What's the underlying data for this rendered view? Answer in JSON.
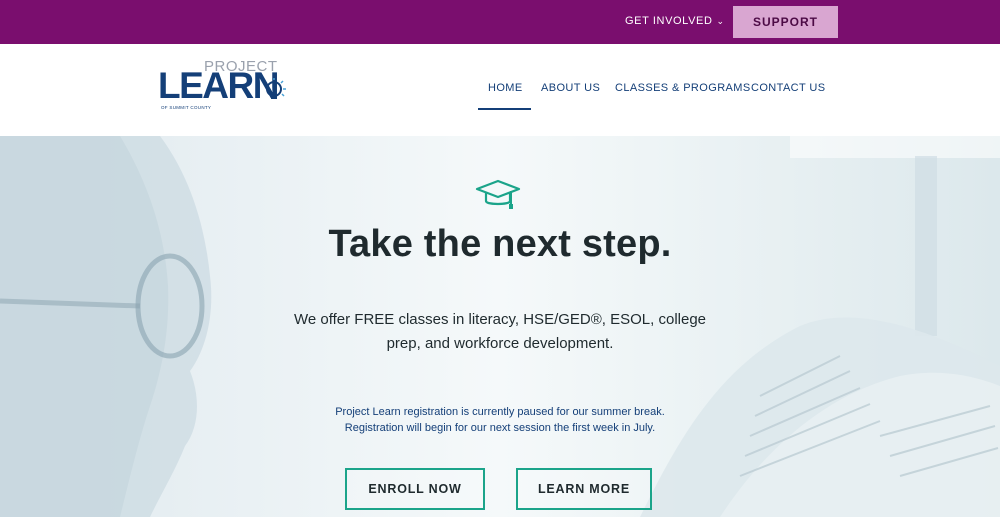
{
  "topbar": {
    "get_involved_label": "GET INVOLVED",
    "get_involved_chevron": "⌄",
    "support_label": "SUPPORT"
  },
  "logo": {
    "project_text": "PROJECT",
    "learn_text": "LEARN",
    "county_text": "OF SUMMIT COUNTY"
  },
  "nav": {
    "items": [
      {
        "label": "HOME"
      },
      {
        "label": "ABOUT US"
      },
      {
        "label": "CLASSES & PROGRAMS"
      },
      {
        "label": "CONTACT US"
      }
    ]
  },
  "hero": {
    "icon": "graduation-cap-icon",
    "headline": "Take the next step.",
    "subtext": "We offer FREE classes in literacy, HSE/GED®, ESOL, college prep, and workforce development.",
    "notice_line1": "Project Learn registration is currently paused for our summer break.",
    "notice_line2": "Registration will begin for our next session the first week in July.",
    "enroll_label": "ENROLL NOW",
    "learn_more_label": "LEARN MORE"
  },
  "colors": {
    "topbar": "#7a0e6e",
    "support_bg": "#d9a6d1",
    "brand_blue": "#143f78",
    "accent_teal": "#1ba48a"
  }
}
